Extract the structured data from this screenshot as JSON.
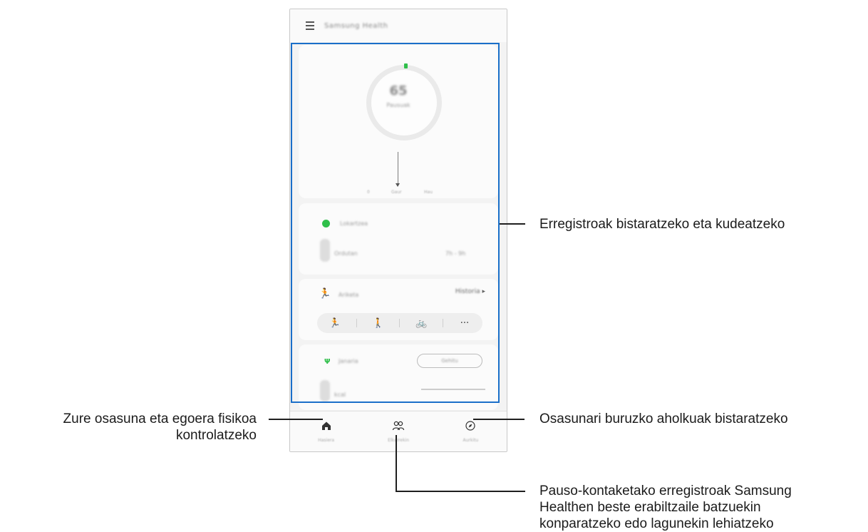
{
  "app": {
    "title": "Samsung Health",
    "menu_icon": "menu-icon"
  },
  "steps_card": {
    "value": "65",
    "unit": "Pausuak",
    "graph_start": "0",
    "graph_mid": "Gaur",
    "graph_end": "Hau"
  },
  "sleep_card": {
    "title": "Lokartzea",
    "value": "0",
    "label": "Ordutan",
    "range": "7h - 9h"
  },
  "exercise_card": {
    "title": "Ariketa",
    "more": "Historia",
    "buttons": [
      "running-icon",
      "walking-icon",
      "cycling-icon",
      "more-icon"
    ],
    "more_label": "···"
  },
  "food_card": {
    "title": "Janaria",
    "button": "Gehitu",
    "value": "0",
    "label": "kcal"
  },
  "bottom_nav": {
    "items": [
      {
        "label": "Hasiera",
        "icon": "home-icon"
      },
      {
        "label": "Elkarrekin",
        "icon": "people-icon"
      },
      {
        "label": "Aurkitu",
        "icon": "compass-icon"
      }
    ]
  },
  "callouts": {
    "records": "Erregistroak bistaratzeko eta kudeatzeko",
    "health_line1": "Zure osasuna eta egoera fisikoa",
    "health_line2": "kontrolatzeko",
    "tips": "Osasunari buruzko aholkuak bistaratzeko",
    "compare_line1": "Pauso-kontaketako erregistroak Samsung",
    "compare_line2": "Healthen beste erabiltzaile batzuekin",
    "compare_line3": "konparatzeko edo lagunekin lehiatzeko"
  },
  "colors": {
    "highlight": "#1a6fc9",
    "accent_green": "#2fbf4a"
  }
}
